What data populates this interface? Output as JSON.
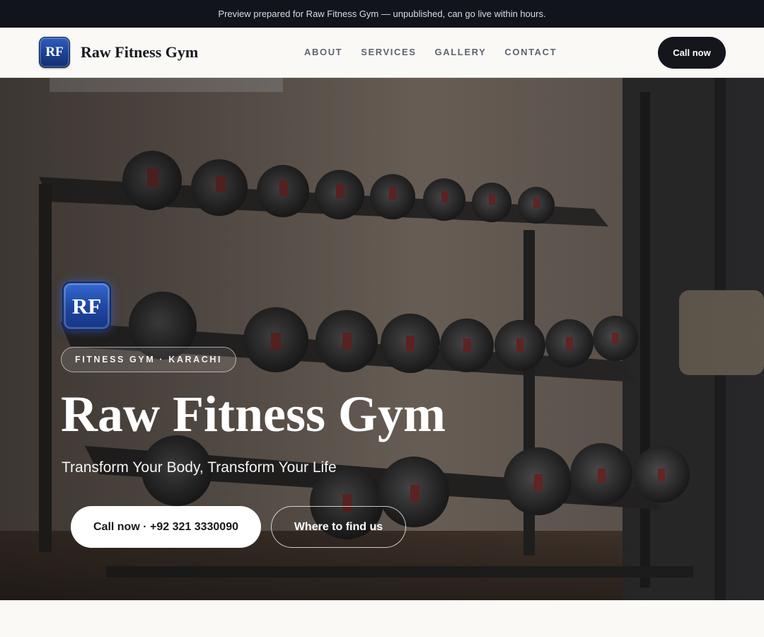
{
  "banner": {
    "text": "Preview prepared for Raw Fitness Gym — unpublished, can go live within hours."
  },
  "header": {
    "logo_initials": "RF",
    "brand_name": "Raw Fitness Gym",
    "nav": [
      "ABOUT",
      "SERVICES",
      "GALLERY",
      "CONTACT"
    ],
    "call_label": "Call now"
  },
  "hero": {
    "background": "photo of a dumbbell rack in a gym",
    "logo_initials": "RF",
    "tag": "FITNESS GYM · KARACHI",
    "title": "Raw Fitness Gym",
    "subtitle": "Transform Your Body, Transform Your Life",
    "primary_cta": "Call now · +92 321 3330090",
    "secondary_cta": "Where to find us"
  },
  "colors": {
    "banner_bg": "#11141a",
    "page_bg": "#faf9f6",
    "call_button_bg": "#14161c",
    "logo_blue": "#1c3f91"
  }
}
